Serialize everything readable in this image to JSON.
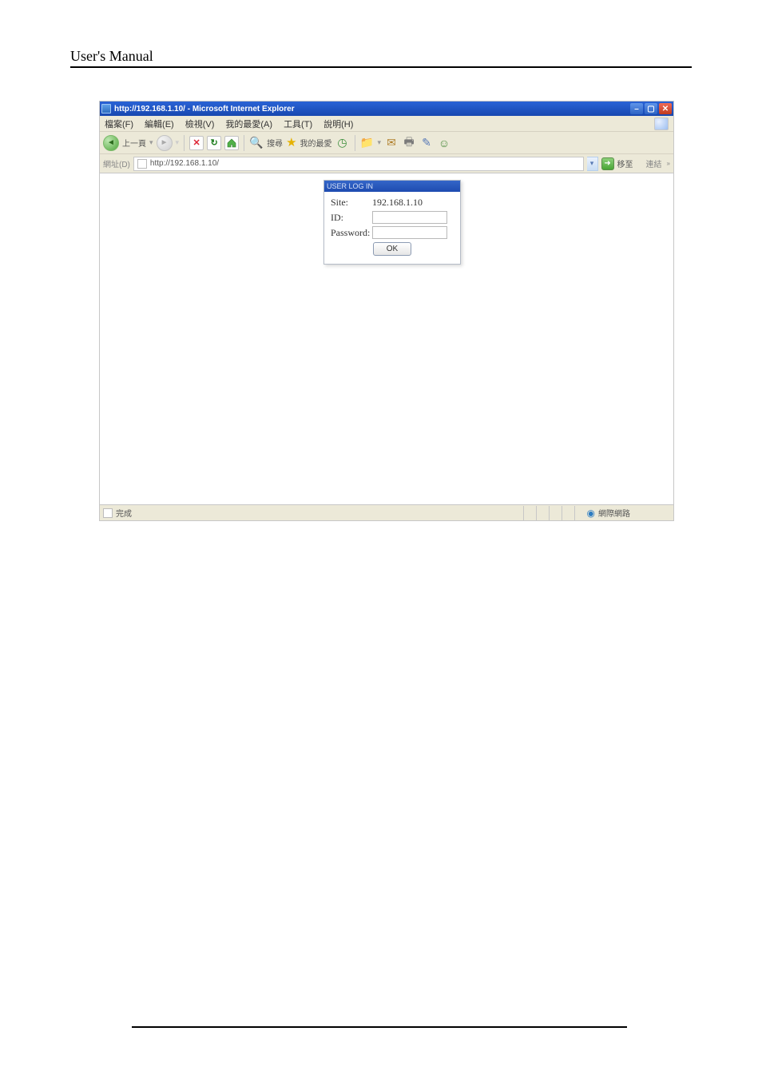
{
  "document": {
    "header": "User's  Manual"
  },
  "ie": {
    "title": "http://192.168.1.10/ - Microsoft Internet Explorer",
    "menu": {
      "file": "檔案(F)",
      "edit": "編輯(E)",
      "view": "檢視(V)",
      "favorites": "我的最愛(A)",
      "tools": "工具(T)",
      "help": "說明(H)"
    },
    "toolbar": {
      "back": "上一頁",
      "search": "搜尋",
      "favorites": "我的最愛"
    },
    "address": {
      "label": "網址(D)",
      "value": "http://192.168.1.10/",
      "go": "移至",
      "links": "連結"
    },
    "login": {
      "title": "USER LOG IN",
      "site_label": "Site:",
      "site_value": "192.168.1.10",
      "id_label": "ID:",
      "id_value": "",
      "pw_label": "Password:",
      "pw_value": "",
      "ok": "OK"
    },
    "status": {
      "done": "完成",
      "zone": "網際網路"
    }
  }
}
